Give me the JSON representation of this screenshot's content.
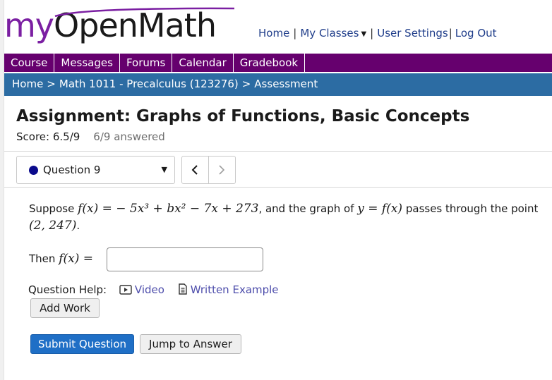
{
  "logo": {
    "my": "my",
    "rest": "OpenMath"
  },
  "top_links": {
    "home": "Home",
    "my_classes": "My Classes",
    "user_settings": "User Settings",
    "log_out": "Log Out",
    "separator": "|"
  },
  "nav": [
    {
      "label": "Course"
    },
    {
      "label": "Messages"
    },
    {
      "label": "Forums"
    },
    {
      "label": "Calendar"
    },
    {
      "label": "Gradebook"
    }
  ],
  "breadcrumb": {
    "home": "Home",
    "course": "Math 1011 - Precalculus (123276)",
    "current": "Assessment",
    "separator": ">"
  },
  "assignment": {
    "title": "Assignment: Graphs of Functions, Basic Concepts",
    "score": "Score: 6.5/9",
    "answered": "6/9 answered"
  },
  "question_select": {
    "selected": "Question 9",
    "status_color": "#0a0a8c"
  },
  "question": {
    "text_suppose": "Suppose",
    "text_and_graph": ", and the graph of",
    "text_passes": "passes through the point",
    "text_period": ".",
    "f_def": "f(x) = − 5x³ + bx² − 7x + 273",
    "graph_of": "y = f(x)",
    "point": "(2, 247)",
    "then_label": "Then",
    "then_math": "f(x) =",
    "answer_value": ""
  },
  "help": {
    "label": "Question Help:",
    "video": "Video",
    "written_example": "Written Example"
  },
  "buttons": {
    "add_work": "Add Work",
    "submit": "Submit Question",
    "jump": "Jump to Answer"
  },
  "colors": {
    "nav_bg": "#66006e",
    "breadcrumb_bg": "#2c6ca3",
    "submit_bg": "#1f6fc6",
    "logo_purple": "#7b1fa2"
  }
}
